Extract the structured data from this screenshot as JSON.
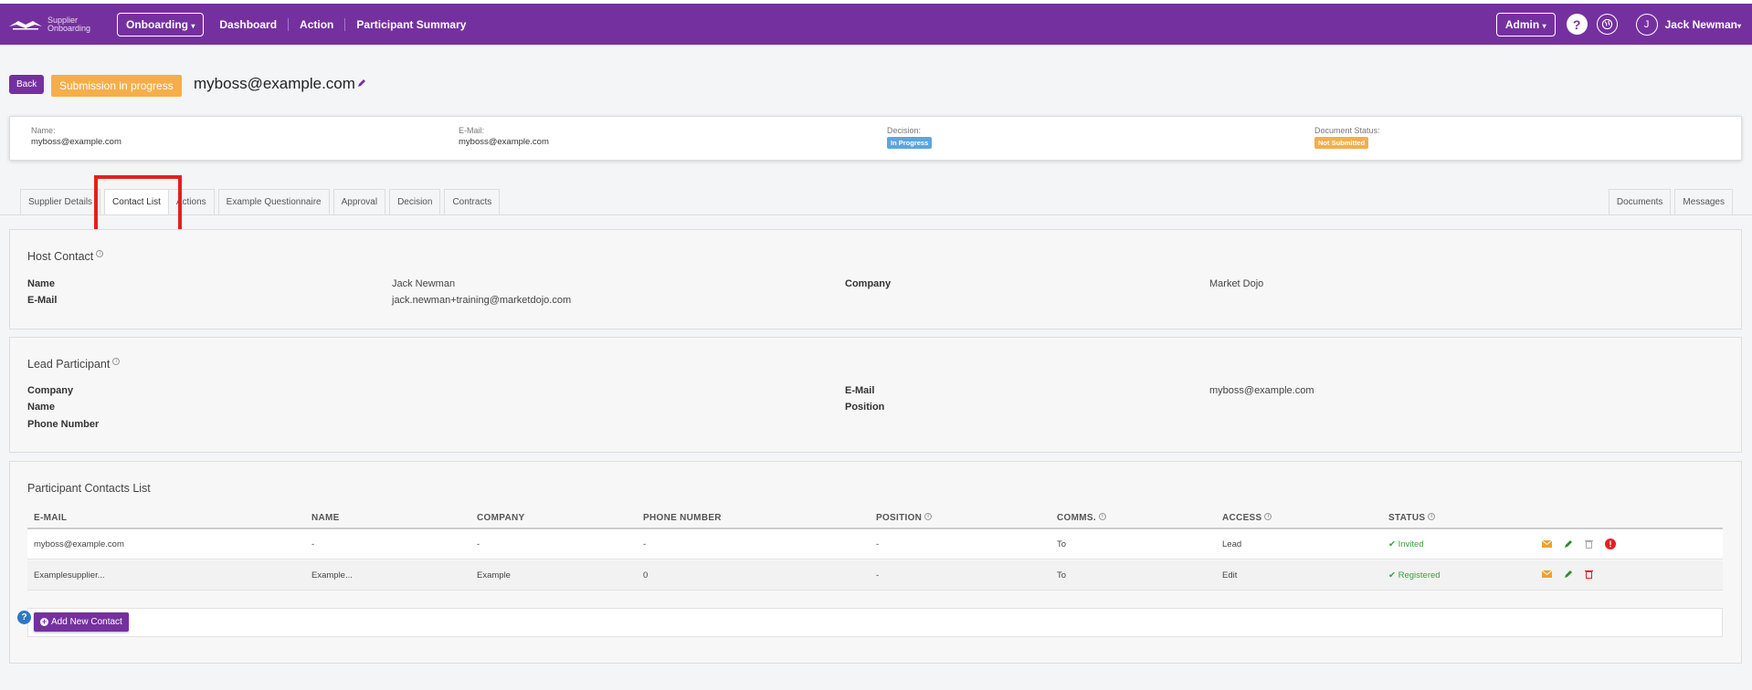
{
  "topbar": {
    "logo_text_line1": "Supplier",
    "logo_text_line2": "Onboarding",
    "module_dropdown": "Onboarding",
    "nav_links": [
      "Dashboard",
      "Action",
      "Participant Summary"
    ],
    "admin_dropdown": "Admin",
    "help_label": "?",
    "avatar_initial": "J",
    "user_name": "Jack Newman"
  },
  "header": {
    "back_label": "Back",
    "status_label": "Submission in progress",
    "title": "myboss@example.com"
  },
  "summary": {
    "name_label": "Name:",
    "name_value": "myboss@example.com",
    "email_label": "E-Mail:",
    "email_value": "myboss@example.com",
    "decision_label": "Decision:",
    "decision_value": "In Progress",
    "document_label": "Document Status:",
    "document_value": "Not Submitted"
  },
  "tabs": [
    "Supplier Details",
    "Contact List",
    "Actions",
    "Example Questionnaire",
    "Approval",
    "Decision",
    "Contracts"
  ],
  "tabs_right": [
    "Documents",
    "Messages"
  ],
  "active_tab": "Contact List",
  "host_contact": {
    "title": "Host Contact",
    "name_label": "Name",
    "name_value": "Jack Newman",
    "email_label": "E-Mail",
    "email_value": "jack.newman+training@marketdojo.com",
    "company_label": "Company",
    "company_value": "Market Dojo"
  },
  "lead_participant": {
    "title": "Lead Participant",
    "company_label": "Company",
    "name_label": "Name",
    "phone_label": "Phone Number",
    "email_label": "E-Mail",
    "email_value": "myboss@example.com",
    "position_label": "Position"
  },
  "contacts": {
    "title": "Participant Contacts List",
    "columns": [
      "E-MAIL",
      "NAME",
      "COMPANY",
      "PHONE NUMBER",
      "POSITION",
      "COMMS.",
      "ACCESS",
      "STATUS"
    ],
    "rows": [
      {
        "email": "myboss@example.com",
        "name": "-",
        "company": "-",
        "phone": "-",
        "position": "-",
        "comms": "To",
        "access": "Lead",
        "status": "Invited"
      },
      {
        "email": "Examplesupplier...",
        "name": "Example...",
        "company": "Example",
        "phone": "0",
        "position": "-",
        "comms": "To",
        "access": "Edit",
        "status": "Registered"
      }
    ],
    "add_label": "Add New Contact"
  },
  "colors": {
    "brand": "#7530a0",
    "status_orange": "#f5ae4a",
    "in_progress_blue": "#5aa6e0",
    "success_green": "#35a33a",
    "danger_red": "#e32020"
  },
  "icons": [
    "logo-icon",
    "caret-down-icon",
    "help-icon",
    "globe-icon",
    "pencil-icon",
    "info-icon",
    "check-icon",
    "envelope-icon",
    "edit-icon",
    "trash-icon",
    "alert-icon",
    "plus-circle-icon",
    "question-icon"
  ]
}
